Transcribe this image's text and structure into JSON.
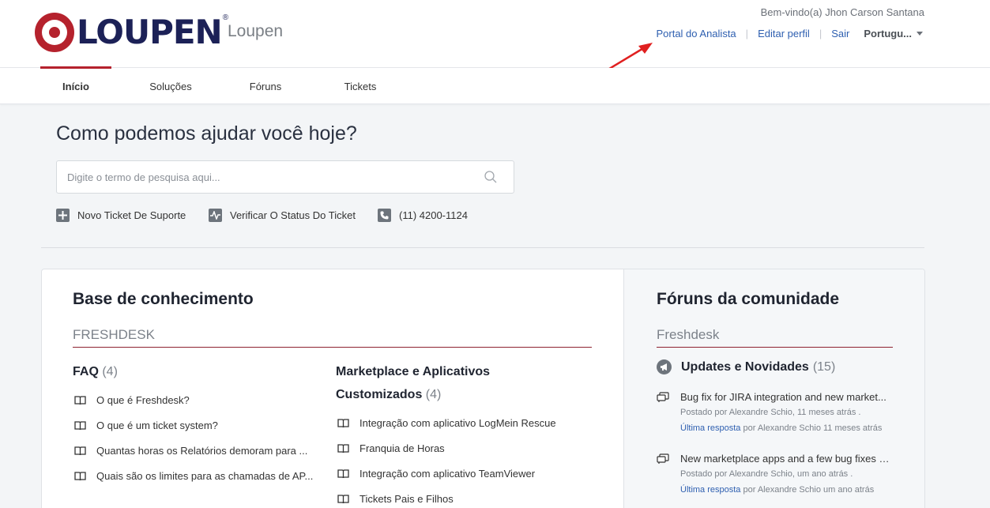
{
  "brand": {
    "logo_text": "LOUPEN",
    "name": "Loupen"
  },
  "header": {
    "welcome": "Bem-vindo(a) Jhon Carson Santana",
    "links": [
      "Portal do Analista",
      "Editar perfil",
      "Sair"
    ],
    "language": "Portugu..."
  },
  "nav": {
    "tabs": [
      "Início",
      "Soluções",
      "Fóruns",
      "Tickets"
    ],
    "active": "Início"
  },
  "hero": {
    "title": "Como podemos ajudar você hoje?",
    "search_placeholder": "Digite o termo de pesquisa aqui...",
    "quick_links": [
      "Novo Ticket De Suporte",
      "Verificar O Status Do Ticket",
      "(11) 4200-1124"
    ]
  },
  "knowledge_base": {
    "title": "Base de conhecimento",
    "subheading": "FRESHDESK",
    "categories": [
      {
        "name": "FAQ",
        "count": "(4)",
        "articles": [
          "O que é Freshdesk?",
          "O que é um ticket system?",
          "Quantas horas os Relatórios demoram para ...",
          "Quais são os limites para as chamadas de AP..."
        ]
      },
      {
        "name": "Marketplace e Aplicativos Customizados",
        "count": "(4)",
        "articles": [
          "Integração com aplicativo LogMein Rescue",
          "Franquia de Horas",
          "Integração com aplicativo TeamViewer",
          "Tickets Pais e Filhos"
        ]
      }
    ]
  },
  "forums": {
    "title": "Fóruns da comunidade",
    "subheading": "Freshdesk",
    "forum_name": "Updates e Novidades",
    "forum_count": "(15)",
    "topics": [
      {
        "title": "Bug fix for JIRA integration and new market...",
        "posted": "Postado por Alexandre Schio, 11 meses atrás .",
        "last_reply_label": "Última resposta",
        "last_reply": "por Alexandre Schio 11 meses atrás"
      },
      {
        "title": "New marketplace apps and a few bug fixes a...",
        "posted": "Postado por Alexandre Schio, um ano atrás .",
        "last_reply_label": "Última resposta",
        "last_reply": "por Alexandre Schio um ano atrás"
      }
    ]
  },
  "colors": {
    "brand_red": "#b5222d",
    "brand_navy": "#1c2157",
    "link_blue": "#2e5fb0",
    "annotation_arrow": "#e02020"
  }
}
